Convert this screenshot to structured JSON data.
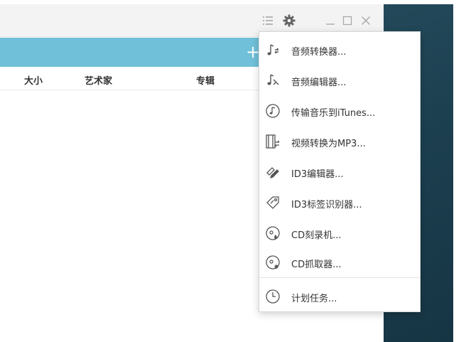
{
  "window": {
    "controls": {
      "menu_icon": "menu-list-icon",
      "settings_icon": "gear-icon",
      "minimize_icon": "minimize-icon",
      "maximize_icon": "maximize-icon",
      "close_icon": "close-icon"
    }
  },
  "toolbar": {
    "add_label": "+",
    "accent_color": "#6fc0d8"
  },
  "columns": [
    {
      "label": "大小"
    },
    {
      "label": "艺术家"
    },
    {
      "label": "专辑"
    }
  ],
  "menu": {
    "items": [
      {
        "label": "音频转换器...",
        "icon": "music-convert-icon"
      },
      {
        "label": "音频编辑器...",
        "icon": "music-edit-icon"
      },
      {
        "label": "传输音乐到iTunes...",
        "icon": "music-disc-icon"
      },
      {
        "label": "视频转换为MP3...",
        "icon": "film-convert-icon"
      },
      {
        "label": "ID3编辑器...",
        "icon": "pencil-tag-icon"
      },
      {
        "label": "ID3标签识别器...",
        "icon": "tag-icon"
      },
      {
        "label": "CD刻录机...",
        "icon": "cd-burn-icon"
      },
      {
        "label": "CD抓取器...",
        "icon": "cd-rip-icon"
      },
      {
        "label": "计划任务...",
        "icon": "clock-icon"
      }
    ]
  }
}
